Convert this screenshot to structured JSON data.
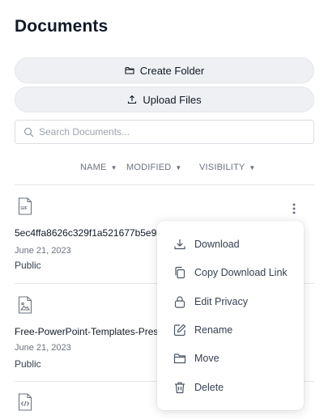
{
  "page": {
    "title": "Documents"
  },
  "actions": {
    "create_folder": "Create Folder",
    "upload_files": "Upload Files"
  },
  "search": {
    "placeholder": "Search Documents..."
  },
  "columns": {
    "name": "NAME",
    "modified": "MODIFIED",
    "visibility": "VISIBILITY"
  },
  "files": [
    {
      "name": "5ec4ffa8626c329f1a521677b5e98",
      "icon": "gif-file-icon",
      "modified": "June 21, 2023",
      "visibility": "Public"
    },
    {
      "name": "Free-PowerPoint-Templates-Pres",
      "icon": "image-file-icon",
      "modified": "June 21, 2023",
      "visibility": "Public"
    },
    {
      "icon": "code-file-icon"
    }
  ],
  "context_menu": {
    "items": [
      {
        "label": "Download",
        "icon": "download-icon"
      },
      {
        "label": "Copy Download Link",
        "icon": "copy-icon"
      },
      {
        "label": "Edit Privacy",
        "icon": "lock-icon"
      },
      {
        "label": "Rename",
        "icon": "edit-icon"
      },
      {
        "label": "Move",
        "icon": "folder-icon"
      },
      {
        "label": "Delete",
        "icon": "trash-icon"
      }
    ]
  },
  "colors": {
    "text_primary": "#111827",
    "text_secondary": "#6b7280",
    "button_bg": "#eef0f3",
    "border": "#e5e7eb"
  }
}
